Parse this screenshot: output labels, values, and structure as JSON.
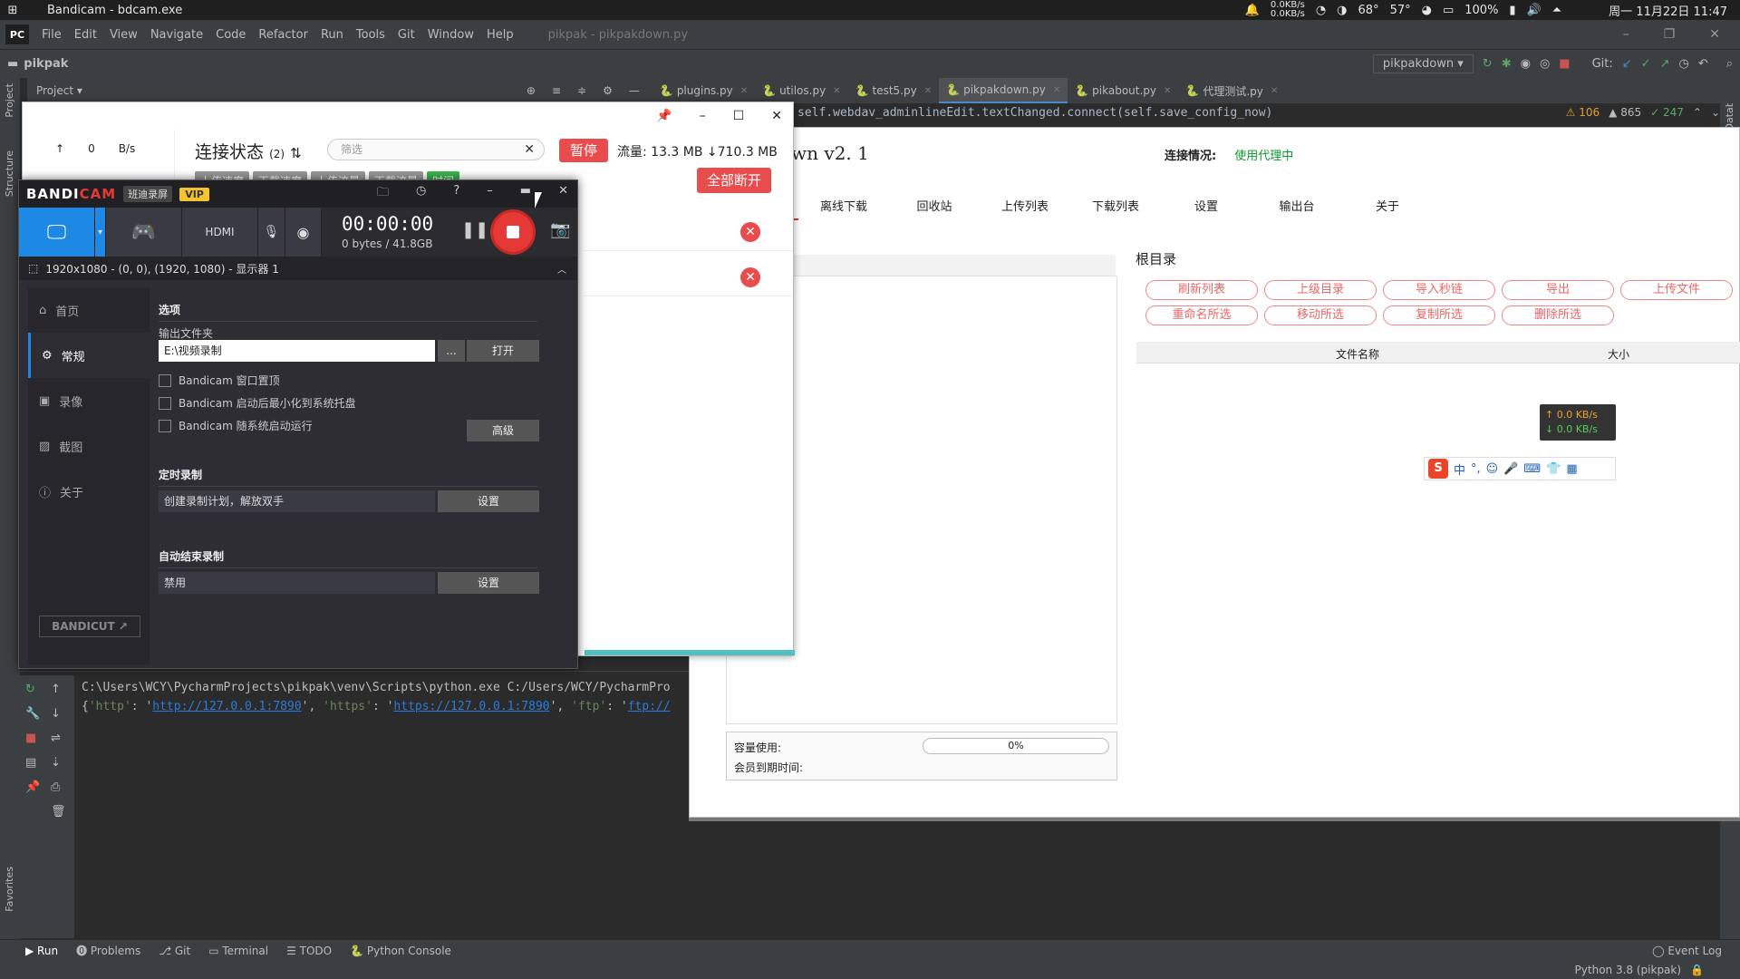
{
  "system": {
    "title": "Bandicam - bdcam.exe",
    "net_up": "0.0KB/s",
    "net_down": "0.0KB/s",
    "temp1": "68°",
    "temp2": "57°",
    "battery": "100%",
    "datetime": "周一 11月22日 11:47"
  },
  "ide": {
    "project": "pikpak",
    "menu": [
      "File",
      "Edit",
      "View",
      "Navigate",
      "Code",
      "Refactor",
      "Run",
      "Tools",
      "Git",
      "Window",
      "Help"
    ],
    "window_title": "pikpak - pikpakdown.py",
    "project_view": "Project",
    "run_config": "pikpakdown",
    "git_label": "Git:",
    "tabs": [
      "plugins.py",
      "utilos.py",
      "test5.py",
      "pikpakdown.py",
      "pikabout.py",
      "代理测试.py"
    ],
    "code_line": "self.webdav_adminlineEdit.textChanged.connect(self.save_config_now)",
    "code_self": "self",
    "warnings": "106",
    "weak": "865",
    "ok": "247",
    "console_line1": "C:\\Users\\WCY\\PycharmProjects\\pikpak\\venv\\Scripts\\python.exe C:/Users/WCY/PycharmPro",
    "console_http_key": "'http'",
    "console_http_val": "http://127.0.0.1:7890",
    "console_https_key": "'https'",
    "console_https_val": "https://127.0.0.1:7890",
    "console_ftp_key": "'ftp'",
    "console_ftp_val": "ftp://",
    "bottom_tabs": [
      "Run",
      "Problems",
      "Git",
      "Terminal",
      "TODO",
      "Python Console"
    ],
    "event_log": "Event Log",
    "interpreter": "Python 3.8 (pikpak)",
    "side_project": "Project",
    "side_structure": "Structure",
    "side_favorites": "Favorites",
    "side_database": "Database"
  },
  "pikpak": {
    "title": "own  v2. 1",
    "status_label": "连接情况:",
    "status_value": "使用代理中",
    "nav": [
      "离线下载",
      "回收站",
      "上传列表",
      "下载列表",
      "设置",
      "输出台",
      "关于"
    ],
    "root": "根目录",
    "buttons_row1": [
      "刷新列表",
      "上级目录",
      "导入秒链",
      "导出",
      "上传文件"
    ],
    "buttons_row2": [
      "重命名所选",
      "移动所选",
      "复制所选",
      "删除所选"
    ],
    "col_name": "文件名称",
    "col_size": "大小",
    "cap_label": "容量使用:",
    "cap_value": "0%",
    "cap_progress": 0,
    "member_label": "会员到期时间:",
    "net_up": "0.0 KB/s",
    "net_down": "0.0 KB/s",
    "ime_items": [
      "中",
      "°,",
      "☺",
      "🎤",
      "⌨",
      "👕",
      "▦"
    ]
  },
  "conn": {
    "speed_value": "0",
    "speed_unit": "B/s",
    "title": "连接状态",
    "count": "(2)",
    "filter_placeholder": "筛选",
    "pause": "暂停",
    "flow": "流量: 13.3 MB ↓710.3 MB",
    "disconnect_all": "全部断开",
    "chips": [
      "上传速度",
      "下载速度",
      "上传流量",
      "下载流量",
      "时间"
    ]
  },
  "bandicam": {
    "logo_a": "BANDI",
    "logo_b": "CAM",
    "tag": "班迪录屏",
    "vip": "VIP",
    "timer": "00:00:00",
    "bytes": "0 bytes / 41.8GB",
    "area": "1920x1080 - (0, 0), (1920, 1080) - 显示器 1",
    "sidebar": [
      "首页",
      "常规",
      "录像",
      "截图",
      "关于"
    ],
    "bandicut": "BANDICUT ↗",
    "options_header": "选项",
    "output_label": "输出文件夹",
    "output_path": "E:\\视频录制",
    "browse": "...",
    "open": "打开",
    "chk1": "Bandicam 窗口置顶",
    "chk2": "Bandicam 启动后最小化到系统托盘",
    "chk3": "Bandicam 随系统启动运行",
    "advanced": "高级",
    "timer_header": "定时录制",
    "timer_field": "创建录制计划，解放双手",
    "settings": "设置",
    "auto_header": "自动结束录制",
    "auto_field": "禁用"
  },
  "colors": {
    "accent_red": "#e84c4c",
    "bandicam_blue": "#1e88e5",
    "proxy_green": "#0a9a2e"
  }
}
